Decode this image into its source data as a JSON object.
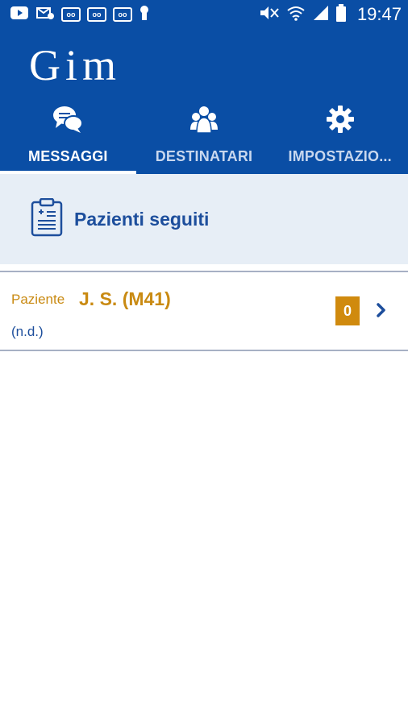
{
  "status_bar": {
    "time": "19:47",
    "left_icons": [
      "youtube-icon",
      "mail-icon",
      "voicemail-icon",
      "voicemail-icon",
      "voicemail-icon",
      "keyhole-icon"
    ],
    "right_icons": [
      "mute-icon",
      "wifi-icon",
      "signal-icon",
      "battery-icon"
    ]
  },
  "app": {
    "logo": "Gim",
    "tabs": [
      {
        "label": "MESSAGGI",
        "icon": "chat-bubbles-icon",
        "active": true
      },
      {
        "label": "DESTINATARI",
        "icon": "group-icon",
        "active": false
      },
      {
        "label": "IMPOSTAZIO...",
        "icon": "gear-icon",
        "active": false
      }
    ]
  },
  "section": {
    "title": "Pazienti seguiti",
    "icon": "clipboard-icon"
  },
  "patients": [
    {
      "label": "Paziente",
      "name": "J. S. (M41)",
      "subtitle": "(n.d.)",
      "count": "0"
    }
  ],
  "colors": {
    "primary": "#0a4ea5",
    "section_bg": "#e7eef6",
    "accent": "#c98a12",
    "badge": "#d08a0e",
    "text_blue": "#1d4e9c"
  }
}
